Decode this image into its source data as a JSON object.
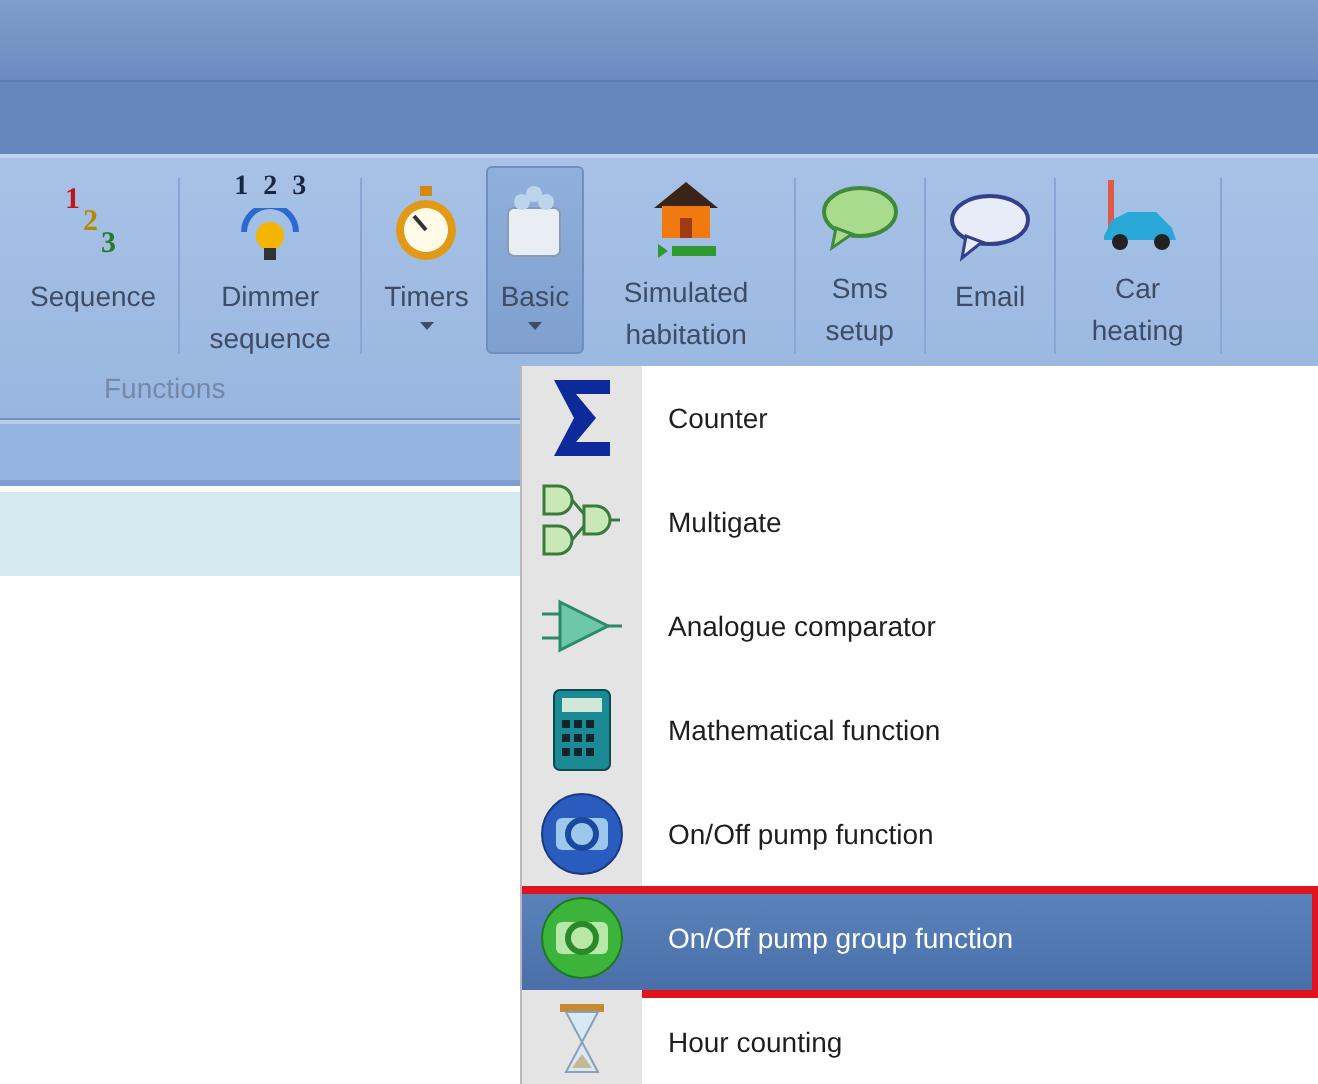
{
  "ribbon": {
    "buttons": [
      {
        "label": "Sequence",
        "kind": "sequence",
        "digits": [
          "1",
          "2",
          "3"
        ],
        "dropdown": false,
        "pressed": false
      },
      {
        "label": "Dimmer sequence",
        "kind": "dimmer",
        "digits": [
          "1",
          "2",
          "3"
        ],
        "dropdown": false,
        "pressed": false
      },
      {
        "label": "Timers",
        "kind": "timer",
        "dropdown": true,
        "pressed": false
      },
      {
        "label": "Basic",
        "kind": "block",
        "dropdown": true,
        "pressed": true
      },
      {
        "label": "Simulated habitation",
        "kind": "house",
        "dropdown": false,
        "pressed": false
      },
      {
        "label": "Sms setup",
        "kind": "sms",
        "dropdown": false,
        "pressed": false
      },
      {
        "label": "Email",
        "kind": "email",
        "dropdown": false,
        "pressed": false
      },
      {
        "label": "Car heating",
        "kind": "car",
        "dropdown": false,
        "pressed": false
      }
    ],
    "group_label": "Functions"
  },
  "menu": {
    "items": [
      {
        "label": "Counter",
        "kind": "sigma",
        "selected": false,
        "highlighted": false
      },
      {
        "label": "Multigate",
        "kind": "gates",
        "selected": false,
        "highlighted": false
      },
      {
        "label": "Analogue comparator",
        "kind": "comparator",
        "selected": false,
        "highlighted": false
      },
      {
        "label": "Mathematical function",
        "kind": "calculator",
        "selected": false,
        "highlighted": false
      },
      {
        "label": "On/Off pump function",
        "kind": "pump-blue",
        "selected": false,
        "highlighted": false
      },
      {
        "label": "On/Off pump group function",
        "kind": "pump-green",
        "selected": true,
        "highlighted": true
      },
      {
        "label": "Hour counting",
        "kind": "hourglass",
        "selected": false,
        "highlighted": false
      }
    ]
  }
}
